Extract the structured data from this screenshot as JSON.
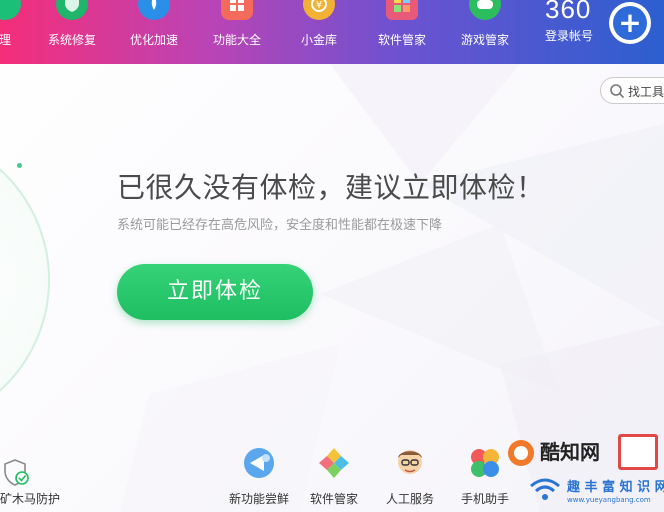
{
  "nav": {
    "items": [
      {
        "label": "理",
        "icon": "cleanup-icon",
        "color": "#1bbf78"
      },
      {
        "label": "系统修复",
        "icon": "shield-repair-icon",
        "color": "#1fb56a"
      },
      {
        "label": "优化加速",
        "icon": "rocket-icon",
        "color": "#2b8fe8"
      },
      {
        "label": "功能大全",
        "icon": "grid-icon",
        "color": "#f46b5b"
      },
      {
        "label": "小金库",
        "icon": "coin-icon",
        "color": "#f2b134"
      },
      {
        "label": "软件管家",
        "icon": "software-manager-icon",
        "color": "#e85a7a"
      },
      {
        "label": "游戏管家",
        "icon": "gamepad-icon",
        "color": "#2bbd5e"
      }
    ],
    "logo": "360",
    "login_label": "登录帐号",
    "plus_icon": "plus-icon"
  },
  "search": {
    "label": "找工具",
    "icon": "search-icon"
  },
  "main": {
    "headline": "已很久没有体检，建议立即体检！",
    "subline": "系统可能已经存在高危风险，安全度和性能都在极速下降",
    "check_button": "立即体检"
  },
  "toolbar": {
    "items": [
      {
        "label": "矿木马防护",
        "icon": "trojan-protection-icon"
      },
      {
        "label": "新功能尝鲜",
        "icon": "new-feature-icon"
      },
      {
        "label": "软件管家",
        "icon": "software-manager-icon"
      },
      {
        "label": "人工服务",
        "icon": "human-service-icon"
      },
      {
        "label": "手机助手",
        "icon": "phone-assistant-icon"
      }
    ]
  },
  "watermark": {
    "line1": "酷知网",
    "line2": "趣 丰 富 知 识 网",
    "url": "www.yueyangbang.com"
  },
  "colors": {
    "accent_green": "#1ebe61",
    "topbar_start": "#f52e7a",
    "topbar_end": "#2c5fcf"
  }
}
